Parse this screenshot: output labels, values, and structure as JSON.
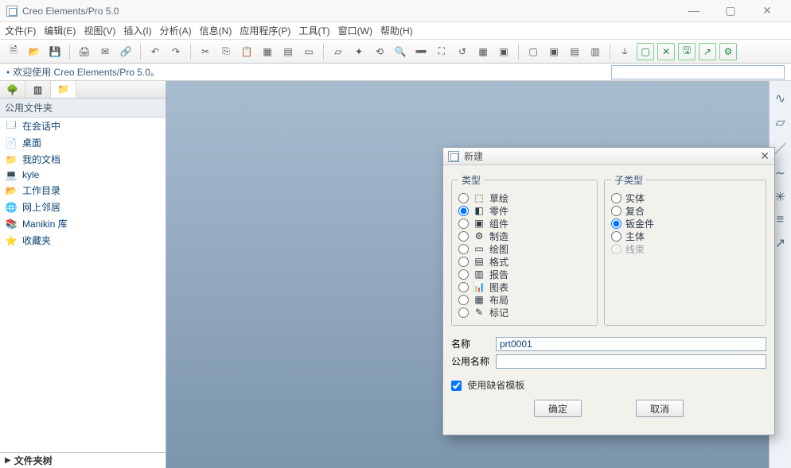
{
  "title": "Creo Elements/Pro 5.0",
  "menu": {
    "file": "文件(F)",
    "edit": "编辑(E)",
    "view": "视图(V)",
    "insert": "插入(I)",
    "analysis": "分析(A)",
    "info": "信息(N)",
    "app": "应用程序(P)",
    "tools": "工具(T)",
    "window": "窗口(W)",
    "help": "帮助(H)"
  },
  "message": {
    "welcome": "欢迎使用 Creo Elements/Pro 5.0。"
  },
  "sidebar": {
    "header": "公用文件夹",
    "items": [
      {
        "icon": "🗔",
        "label": "在会话中"
      },
      {
        "icon": "📄",
        "label": "桌面"
      },
      {
        "icon": "📁",
        "label": "我的文档"
      },
      {
        "icon": "💻",
        "label": "kyle"
      },
      {
        "icon": "📂",
        "label": "工作目录"
      },
      {
        "icon": "🌐",
        "label": "网上邻居"
      },
      {
        "icon": "📚",
        "label": "Manikin 库"
      },
      {
        "icon": "⭐",
        "label": "收藏夹"
      }
    ],
    "tree_label": "文件夹树"
  },
  "dialog": {
    "title": "新建",
    "type_legend": "类型",
    "subtype_legend": "子类型",
    "types": [
      {
        "icon": "⬚",
        "label": "草绘"
      },
      {
        "icon": "◧",
        "label": "零件"
      },
      {
        "icon": "▣",
        "label": "组件"
      },
      {
        "icon": "⚙",
        "label": "制造"
      },
      {
        "icon": "▭",
        "label": "绘图"
      },
      {
        "icon": "▤",
        "label": "格式"
      },
      {
        "icon": "▥",
        "label": "报告"
      },
      {
        "icon": "📊",
        "label": "图表"
      },
      {
        "icon": "▦",
        "label": "布局"
      },
      {
        "icon": "✎",
        "label": "标记"
      }
    ],
    "selected_type": 1,
    "subtypes": [
      {
        "label": "实体"
      },
      {
        "label": "复合"
      },
      {
        "label": "钣金件"
      },
      {
        "label": "主体"
      },
      {
        "label": "线束",
        "disabled": true
      }
    ],
    "selected_subtype": 2,
    "name_label": "名称",
    "common_name_label": "公用名称",
    "name_value": "prt0001",
    "common_name_value": "",
    "chk_label": "使用缺省模板",
    "ok": "确定",
    "cancel": "取消"
  }
}
